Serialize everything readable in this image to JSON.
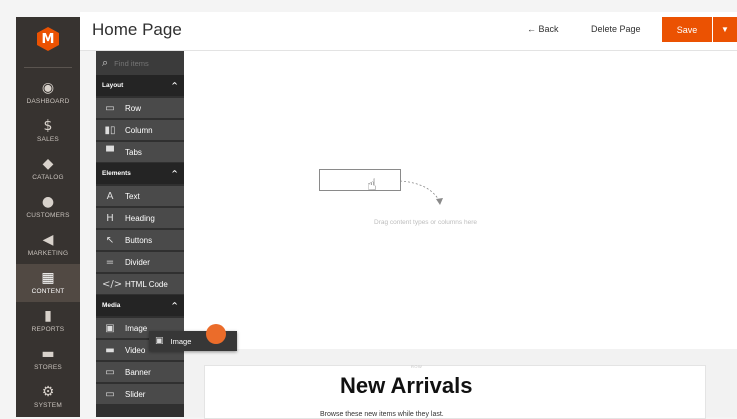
{
  "nav": {
    "logo": "M",
    "items": [
      {
        "label": "DASHBOARD",
        "icon": "dashboard-icon",
        "glyph": "◉"
      },
      {
        "label": "SALES",
        "icon": "dollar-icon",
        "glyph": "$"
      },
      {
        "label": "CATALOG",
        "icon": "catalog-cube-icon",
        "glyph": "◆"
      },
      {
        "label": "CUSTOMERS",
        "icon": "customers-person-icon",
        "glyph": "●"
      },
      {
        "label": "MARKETING",
        "icon": "marketing-megaphone-icon",
        "glyph": "◀"
      },
      {
        "label": "CONTENT",
        "icon": "content-icon",
        "glyph": "▦"
      },
      {
        "label": "REPORTS",
        "icon": "reports-bar-icon",
        "glyph": "▮"
      },
      {
        "label": "STORES",
        "icon": "stores-icon",
        "glyph": "▬"
      },
      {
        "label": "SYSTEM",
        "icon": "system-gear-icon",
        "glyph": "⚙"
      }
    ],
    "active": "CONTENT"
  },
  "header": {
    "title": "Home Page",
    "back_label": "← Back",
    "delete_label": "Delete Page",
    "save_label": "Save",
    "save_dropdown_glyph": "▼"
  },
  "panel": {
    "search_placeholder": "Find items",
    "sections": [
      {
        "title": "Layout",
        "chevron": "^",
        "items": [
          {
            "label": "Row",
            "glyph": "▭"
          },
          {
            "label": "Column",
            "glyph": "▮▯"
          },
          {
            "label": "Tabs",
            "glyph": "▀"
          }
        ]
      },
      {
        "title": "Elements",
        "chevron": "^",
        "items": [
          {
            "label": "Text",
            "glyph": "A"
          },
          {
            "label": "Heading",
            "glyph": "H"
          },
          {
            "label": "Buttons",
            "glyph": "↖"
          },
          {
            "label": "Divider",
            "glyph": "="
          },
          {
            "label": "HTML Code",
            "glyph": "</>"
          }
        ]
      },
      {
        "title": "Media",
        "chevron": "^",
        "items": [
          {
            "label": "Image",
            "glyph": "▣"
          },
          {
            "label": "Video",
            "glyph": "▬"
          },
          {
            "label": "Banner",
            "glyph": "▭"
          },
          {
            "label": "Slider",
            "glyph": "▭"
          }
        ]
      }
    ]
  },
  "stage": {
    "hint": "Drag content types or columns here",
    "hand_glyph": "☝"
  },
  "drag_chip": {
    "label": "Image",
    "glyph": "▣"
  },
  "preview": {
    "row_tag": "ROW",
    "title": "New Arrivals",
    "subtitle": "Browse these new items while they last."
  },
  "colors": {
    "accent": "#eb5202",
    "nav_bg": "#373330",
    "panel_bg": "#303030"
  }
}
